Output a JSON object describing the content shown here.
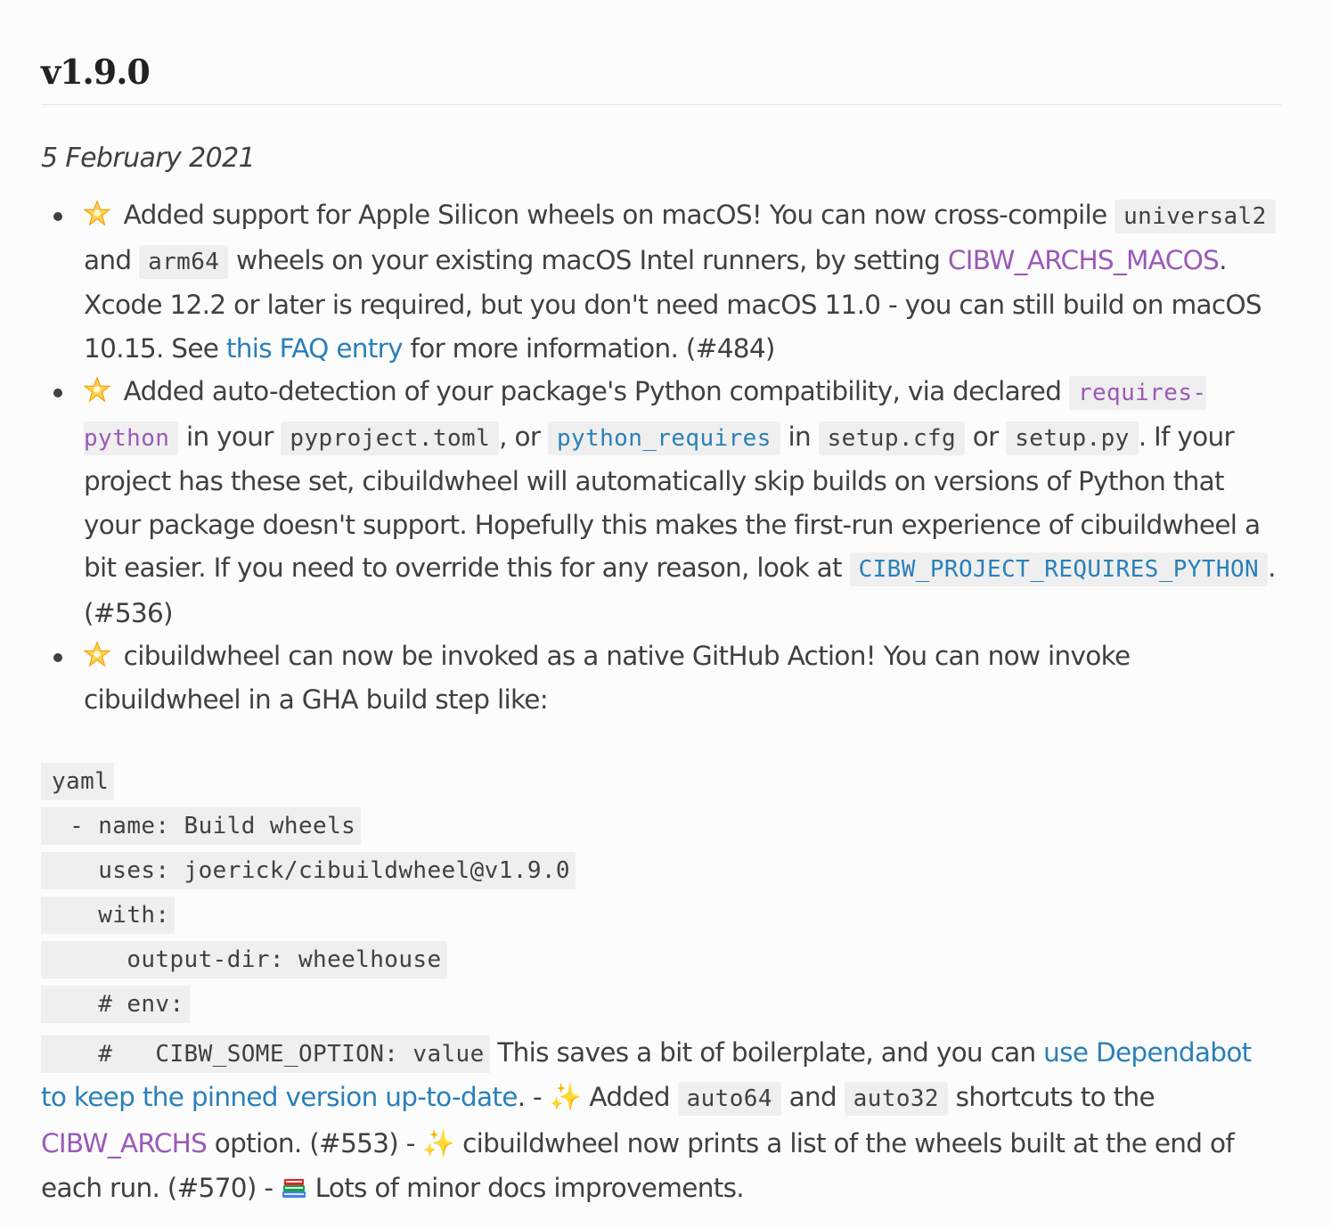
{
  "heading": "v1.9.0",
  "date": "5 February 2021",
  "items": [
    {
      "t1": " Added support for Apple Silicon wheels on macOS! You can now cross-compile ",
      "c1": "universal2",
      "t2": " and ",
      "c2": "arm64",
      "t3": " wheels on your existing macOS Intel runners, by setting ",
      "link1": "CIBW_ARCHS_MACOS",
      "t4": ". Xcode 12.2 or later is required, but you don't need macOS 11.0 - you can still build on macOS 10.15. See ",
      "link2": "this FAQ entry",
      "t5": " for more information. (#484)"
    },
    {
      "t1": " Added auto-detection of your package's Python compatibility, via declared ",
      "c1": "requires-python",
      "t2": " in your ",
      "c2": "pyproject.toml",
      "t3": ", or ",
      "c3": "python_requires",
      "t4": " in ",
      "c4": "setup.cfg",
      "t5": " or ",
      "c5": "setup.py",
      "t6": ". If your project has these set, cibuildwheel will automatically skip builds on versions of Python that your package doesn't support. Hopefully this makes the first-run experience of cibuildwheel a bit easier. If you need to override this for any reason, look at ",
      "c6": "CIBW_PROJECT_REQUIRES_PYTHON",
      "t7": ". (#536)"
    },
    {
      "t1": " cibuildwheel can now be invoked as a native GitHub Action! You can now invoke cibuildwheel in a GHA build step like:"
    }
  ],
  "code_lines": [
    "yaml",
    "  - name: Build wheels",
    "    uses: joerick/cibuildwheel@v1.9.0",
    "    with:",
    "      output-dir: wheelhouse",
    "    # env:",
    "    #   CIBW_SOME_OPTION: value"
  ],
  "tail": {
    "t1": " This saves a bit of boilerplate, and you can ",
    "link1": "use Dependabot to keep the pinned version up-to-date",
    "t2": ". - ",
    "t3": " Added ",
    "c1": "auto64",
    "t4": " and ",
    "c2": "auto32",
    "t5": " shortcuts to the ",
    "link2": "CIBW_ARCHS",
    "t6": " option. (#553) - ",
    "t7": " cibuildwheel now prints a list of the wheels built at the end of each run. (#570) - ",
    "t8": " Lots of minor docs improvements."
  },
  "icons": {
    "star": "glowing-star",
    "sparkles": "sparkles",
    "books": "books"
  }
}
